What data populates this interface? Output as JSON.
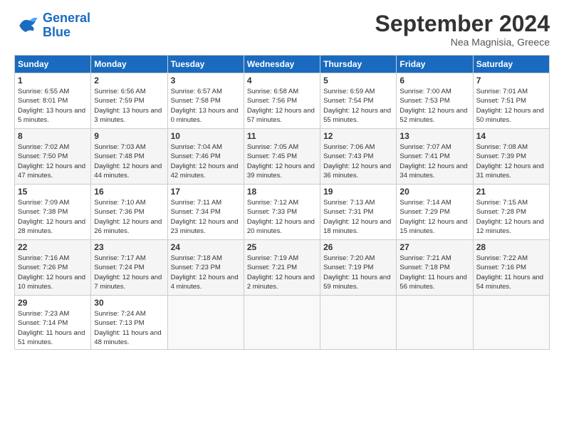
{
  "logo": {
    "line1": "General",
    "line2": "Blue"
  },
  "title": "September 2024",
  "location": "Nea Magnisia, Greece",
  "weekdays": [
    "Sunday",
    "Monday",
    "Tuesday",
    "Wednesday",
    "Thursday",
    "Friday",
    "Saturday"
  ],
  "weeks": [
    [
      {
        "day": 1,
        "sunrise": "6:55 AM",
        "sunset": "8:01 PM",
        "daylight": "13 hours and 5 minutes."
      },
      {
        "day": 2,
        "sunrise": "6:56 AM",
        "sunset": "7:59 PM",
        "daylight": "13 hours and 3 minutes."
      },
      {
        "day": 3,
        "sunrise": "6:57 AM",
        "sunset": "7:58 PM",
        "daylight": "13 hours and 0 minutes."
      },
      {
        "day": 4,
        "sunrise": "6:58 AM",
        "sunset": "7:56 PM",
        "daylight": "12 hours and 57 minutes."
      },
      {
        "day": 5,
        "sunrise": "6:59 AM",
        "sunset": "7:54 PM",
        "daylight": "12 hours and 55 minutes."
      },
      {
        "day": 6,
        "sunrise": "7:00 AM",
        "sunset": "7:53 PM",
        "daylight": "12 hours and 52 minutes."
      },
      {
        "day": 7,
        "sunrise": "7:01 AM",
        "sunset": "7:51 PM",
        "daylight": "12 hours and 50 minutes."
      }
    ],
    [
      {
        "day": 8,
        "sunrise": "7:02 AM",
        "sunset": "7:50 PM",
        "daylight": "12 hours and 47 minutes."
      },
      {
        "day": 9,
        "sunrise": "7:03 AM",
        "sunset": "7:48 PM",
        "daylight": "12 hours and 44 minutes."
      },
      {
        "day": 10,
        "sunrise": "7:04 AM",
        "sunset": "7:46 PM",
        "daylight": "12 hours and 42 minutes."
      },
      {
        "day": 11,
        "sunrise": "7:05 AM",
        "sunset": "7:45 PM",
        "daylight": "12 hours and 39 minutes."
      },
      {
        "day": 12,
        "sunrise": "7:06 AM",
        "sunset": "7:43 PM",
        "daylight": "12 hours and 36 minutes."
      },
      {
        "day": 13,
        "sunrise": "7:07 AM",
        "sunset": "7:41 PM",
        "daylight": "12 hours and 34 minutes."
      },
      {
        "day": 14,
        "sunrise": "7:08 AM",
        "sunset": "7:39 PM",
        "daylight": "12 hours and 31 minutes."
      }
    ],
    [
      {
        "day": 15,
        "sunrise": "7:09 AM",
        "sunset": "7:38 PM",
        "daylight": "12 hours and 28 minutes."
      },
      {
        "day": 16,
        "sunrise": "7:10 AM",
        "sunset": "7:36 PM",
        "daylight": "12 hours and 26 minutes."
      },
      {
        "day": 17,
        "sunrise": "7:11 AM",
        "sunset": "7:34 PM",
        "daylight": "12 hours and 23 minutes."
      },
      {
        "day": 18,
        "sunrise": "7:12 AM",
        "sunset": "7:33 PM",
        "daylight": "12 hours and 20 minutes."
      },
      {
        "day": 19,
        "sunrise": "7:13 AM",
        "sunset": "7:31 PM",
        "daylight": "12 hours and 18 minutes."
      },
      {
        "day": 20,
        "sunrise": "7:14 AM",
        "sunset": "7:29 PM",
        "daylight": "12 hours and 15 minutes."
      },
      {
        "day": 21,
        "sunrise": "7:15 AM",
        "sunset": "7:28 PM",
        "daylight": "12 hours and 12 minutes."
      }
    ],
    [
      {
        "day": 22,
        "sunrise": "7:16 AM",
        "sunset": "7:26 PM",
        "daylight": "12 hours and 10 minutes."
      },
      {
        "day": 23,
        "sunrise": "7:17 AM",
        "sunset": "7:24 PM",
        "daylight": "12 hours and 7 minutes."
      },
      {
        "day": 24,
        "sunrise": "7:18 AM",
        "sunset": "7:23 PM",
        "daylight": "12 hours and 4 minutes."
      },
      {
        "day": 25,
        "sunrise": "7:19 AM",
        "sunset": "7:21 PM",
        "daylight": "12 hours and 2 minutes."
      },
      {
        "day": 26,
        "sunrise": "7:20 AM",
        "sunset": "7:19 PM",
        "daylight": "11 hours and 59 minutes."
      },
      {
        "day": 27,
        "sunrise": "7:21 AM",
        "sunset": "7:18 PM",
        "daylight": "11 hours and 56 minutes."
      },
      {
        "day": 28,
        "sunrise": "7:22 AM",
        "sunset": "7:16 PM",
        "daylight": "11 hours and 54 minutes."
      }
    ],
    [
      {
        "day": 29,
        "sunrise": "7:23 AM",
        "sunset": "7:14 PM",
        "daylight": "11 hours and 51 minutes."
      },
      {
        "day": 30,
        "sunrise": "7:24 AM",
        "sunset": "7:13 PM",
        "daylight": "11 hours and 48 minutes."
      },
      null,
      null,
      null,
      null,
      null
    ]
  ]
}
